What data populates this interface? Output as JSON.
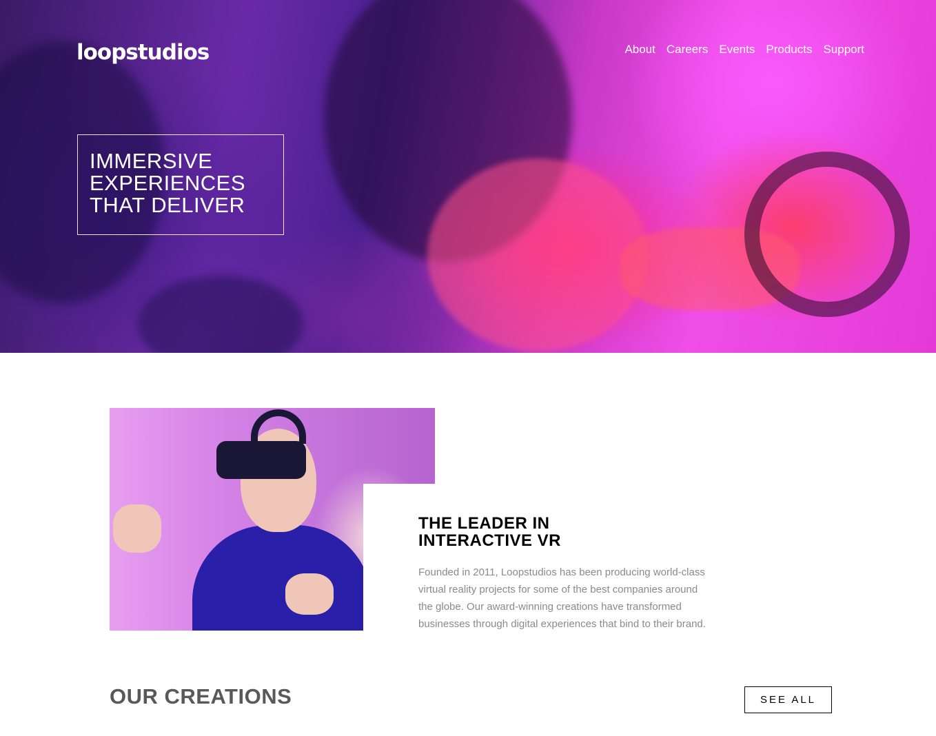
{
  "brand": {
    "logo": "loopstudios"
  },
  "nav": {
    "items": [
      {
        "label": "About"
      },
      {
        "label": "Careers"
      },
      {
        "label": "Events"
      },
      {
        "label": "Products"
      },
      {
        "label": "Support"
      }
    ]
  },
  "hero": {
    "headline_lines": [
      "IMMERSIVE",
      "EXPERIENCES",
      "THAT DELIVER"
    ]
  },
  "about": {
    "title_lines": [
      "THE LEADER IN",
      "INTERACTIVE VR"
    ],
    "text_lines": [
      "Founded in 2011, Loopstudios has been producing world-class",
      "virtual reality projects for some of the best companies around",
      "the globe. Our award-winning creations have transformed",
      "businesses through digital experiences that bind to their brand."
    ]
  },
  "creations": {
    "title": "OUR CREATIONS",
    "see_all_label": "SEE ALL"
  }
}
